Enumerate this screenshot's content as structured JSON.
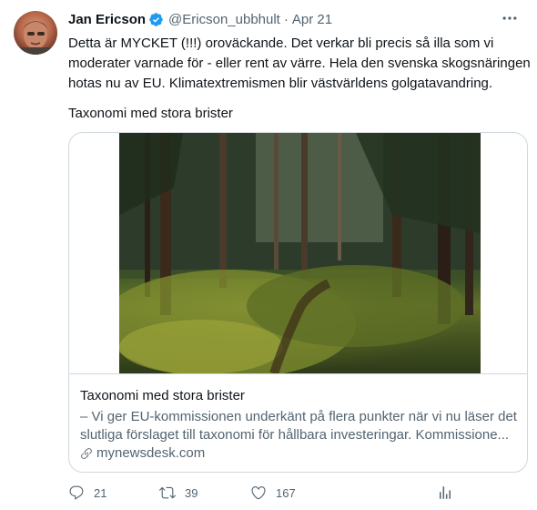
{
  "tweet": {
    "display_name": "Jan Ericson",
    "handle": "@Ericson_ubbhult",
    "separator": "·",
    "date": "Apr 21",
    "text_lines": [
      "Detta är MYCKET (!!!) oroväckande. Det verkar bli precis så illa som vi",
      "moderater varnade för - eller rent av värre. Hela den svenska skogsnäringen",
      "hotas nu av EU.  Klimatextremismen blir västvärldens golgatavandring."
    ],
    "subline": "Taxonomi med stora brister"
  },
  "card": {
    "title": "Taxonomi med stora brister",
    "description_lines": [
      "– Vi ger EU-kommissionen underkänt på flera punkter när vi nu läser det",
      "slutliga förslaget till taxonomi för hållbara investeringar. Kommissione..."
    ],
    "domain": "mynewsdesk.com"
  },
  "actions": {
    "replies": "21",
    "retweets": "39",
    "likes": "167"
  },
  "icons": [
    "verified-badge-icon",
    "more-icon",
    "link-icon",
    "reply-icon",
    "retweet-icon",
    "like-icon",
    "share-icon"
  ],
  "colors": {
    "text": "#0f1419",
    "secondary": "#536471",
    "verified": "#1d9bf0",
    "border": "#cfd9de"
  }
}
